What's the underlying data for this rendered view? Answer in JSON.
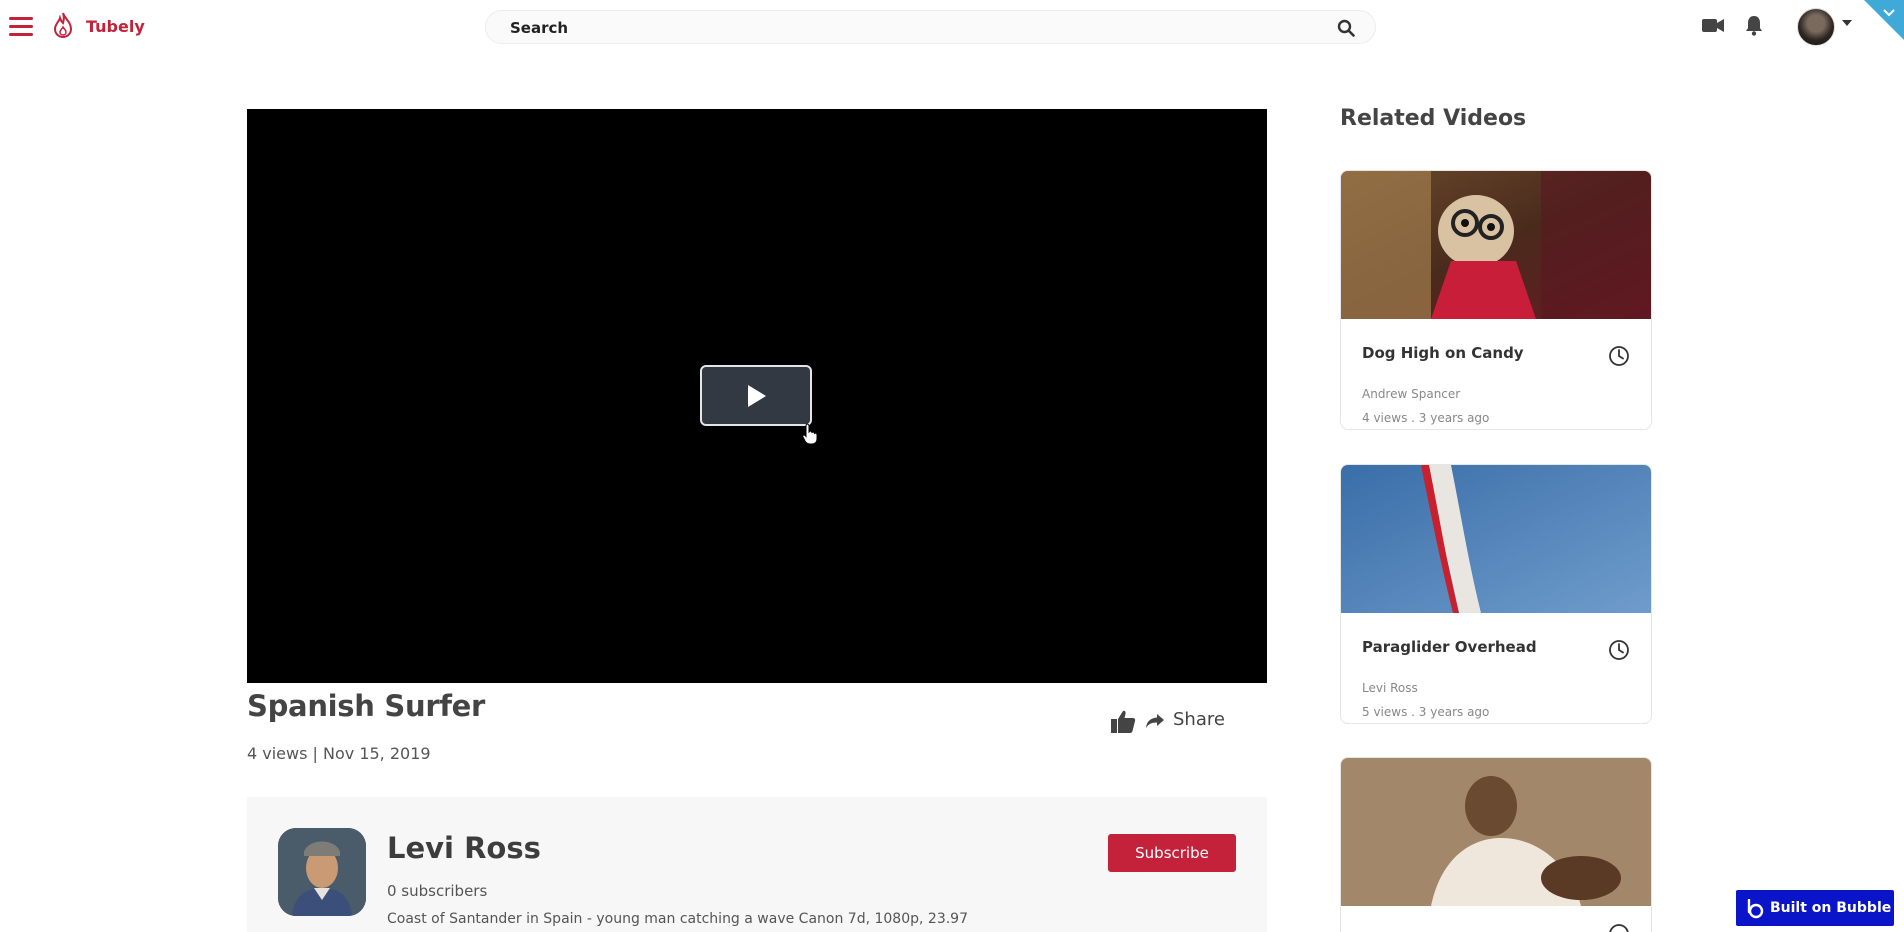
{
  "header": {
    "app_name": "Tubely",
    "search_placeholder": "Search",
    "brand_color": "#c4213a"
  },
  "video": {
    "title": "Spanish Surfer",
    "meta": "4 views | Nov 15, 2019",
    "share_label": "Share"
  },
  "channel": {
    "name": "Levi Ross",
    "subscribers": "0 subscribers",
    "description": "Coast of Santander in Spain - young man catching a wave Canon 7d, 1080p, 23.97",
    "subscribe_label": "Subscribe"
  },
  "related": {
    "heading": "Related Videos",
    "items": [
      {
        "title": "Dog High on Candy",
        "author": "Andrew Spancer",
        "stats": "4 views . 3 years ago"
      },
      {
        "title": "Paraglider Overhead",
        "author": "Levi Ross",
        "stats": "5 views . 3 years ago"
      },
      {
        "title": "",
        "author": "",
        "stats": ""
      }
    ]
  },
  "badge": {
    "label": "Built on Bubble",
    "color": "#0a14c8"
  }
}
